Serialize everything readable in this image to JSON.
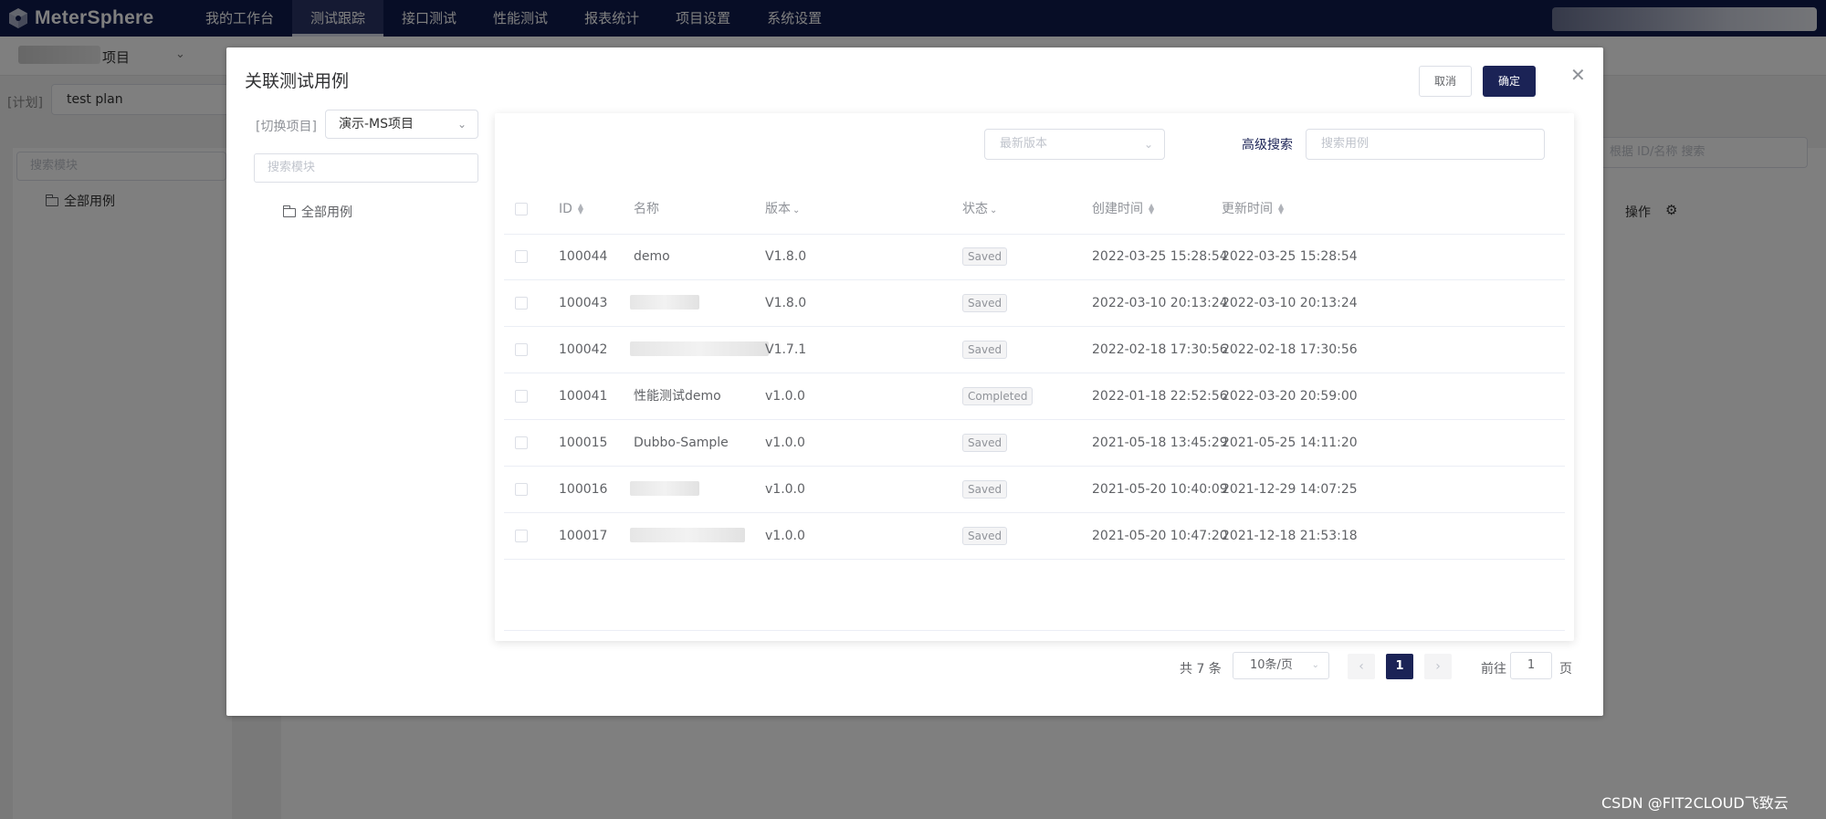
{
  "app": {
    "name": "MeterSphere"
  },
  "nav": [
    {
      "label": "我的工作台",
      "active": false
    },
    {
      "label": "测试跟踪",
      "active": true
    },
    {
      "label": "接口测试",
      "active": false
    },
    {
      "label": "性能测试",
      "active": false
    },
    {
      "label": "报表统计",
      "active": false
    },
    {
      "label": "项目设置",
      "active": false
    },
    {
      "label": "系统设置",
      "active": false
    }
  ],
  "background": {
    "project_suffix": "项目",
    "plan_label": "[计划]",
    "plan_value": "test plan",
    "module_search_placeholder": "搜索模块",
    "tree_root": "全部用例",
    "search_placeholder": "根据 ID/名称 搜索",
    "ops_label": "操作"
  },
  "dialog": {
    "title": "关联测试用例",
    "cancel_label": "取消",
    "confirm_label": "确定",
    "switch_project_label": "[切换项目]",
    "project_value": "演示-MS项目",
    "module_search_placeholder": "搜索模块",
    "tree_root": "全部用例",
    "version_placeholder": "最新版本",
    "advanced_search_label": "高级搜索",
    "case_search_placeholder": "搜索用例",
    "columns": {
      "id": "ID",
      "name": "名称",
      "version": "版本",
      "status": "状态",
      "created": "创建时间",
      "updated": "更新时间"
    },
    "rows": [
      {
        "id": "100044",
        "name": "demo",
        "version": "V1.8.0",
        "status": "Saved",
        "created": "2022-03-25 15:28:54",
        "updated": "2022-03-25 15:28:54"
      },
      {
        "id": "100043",
        "name": "",
        "version": "V1.8.0",
        "status": "Saved",
        "created": "2022-03-10 20:13:24",
        "updated": "2022-03-10 20:13:24"
      },
      {
        "id": "100042",
        "name": "",
        "version": "V1.7.1",
        "status": "Saved",
        "created": "2022-02-18 17:30:56",
        "updated": "2022-02-18 17:30:56"
      },
      {
        "id": "100041",
        "name": "性能测试demo",
        "version": "v1.0.0",
        "status": "Completed",
        "created": "2022-01-18 22:52:56",
        "updated": "2022-03-20 20:59:00"
      },
      {
        "id": "100015",
        "name": "Dubbo-Sample",
        "version": "v1.0.0",
        "status": "Saved",
        "created": "2021-05-18 13:45:29",
        "updated": "2021-05-25 14:11:20"
      },
      {
        "id": "100016",
        "name": "",
        "version": "v1.0.0",
        "status": "Saved",
        "created": "2021-05-20 10:40:09",
        "updated": "2021-12-29 14:07:25"
      },
      {
        "id": "100017",
        "name": "",
        "version": "v1.0.0",
        "status": "Saved",
        "created": "2021-05-20 10:47:20",
        "updated": "2021-12-18 21:53:18"
      }
    ],
    "pagination": {
      "total_text": "共 7 条",
      "page_size": "10条/页",
      "current_page": "1",
      "goto_label": "前往",
      "goto_value": "1",
      "goto_suffix": "页"
    }
  },
  "watermark": "CSDN @FIT2CLOUD飞致云",
  "colors": {
    "nav_bg": "#0f1b4d",
    "primary": "#1b2356"
  }
}
